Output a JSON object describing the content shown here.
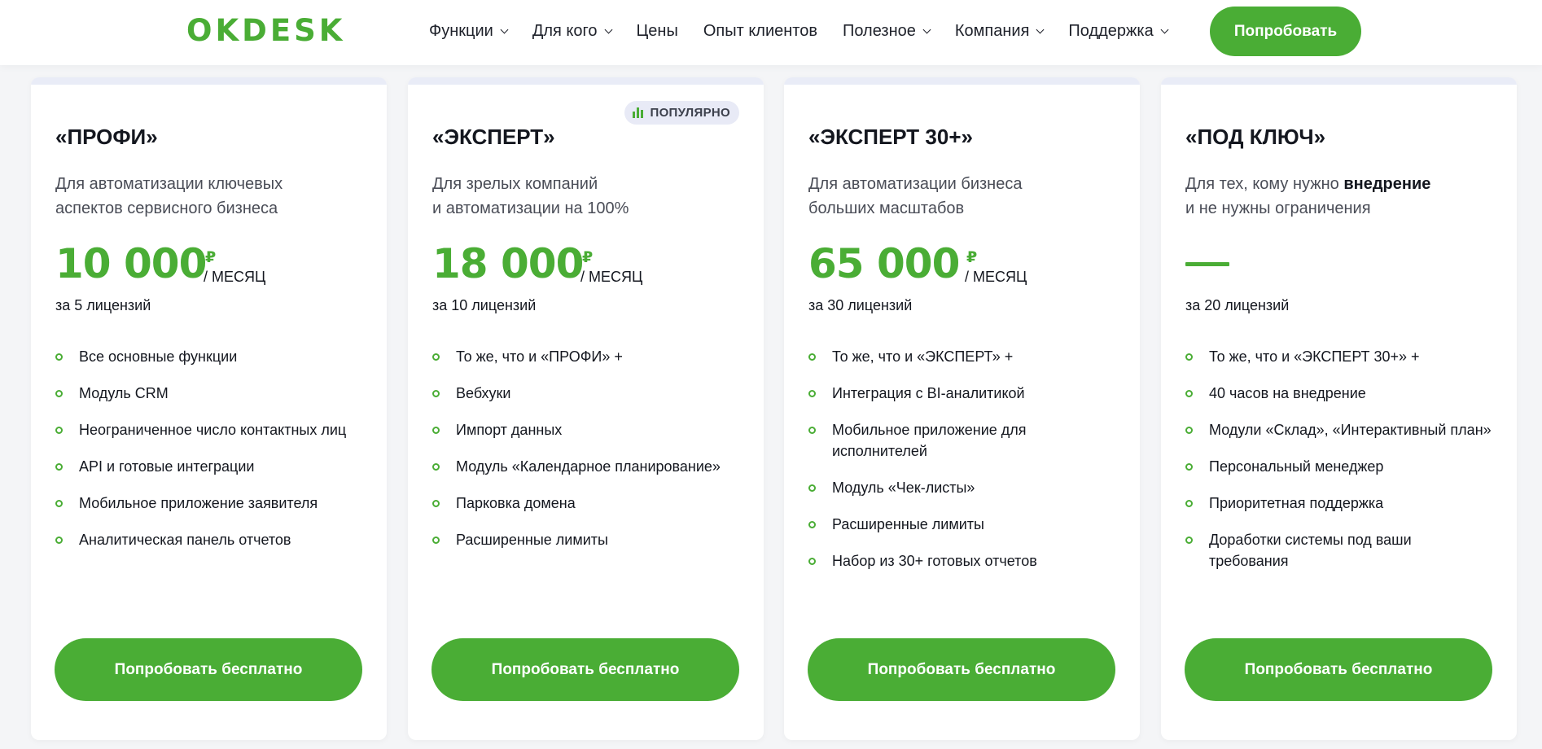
{
  "header": {
    "logo": "OKDESK",
    "nav": [
      {
        "label": "Функции",
        "has_dropdown": true
      },
      {
        "label": "Для кого",
        "has_dropdown": true
      },
      {
        "label": "Цены",
        "has_dropdown": false
      },
      {
        "label": "Опыт клиентов",
        "has_dropdown": false
      },
      {
        "label": "Полезное",
        "has_dropdown": true
      },
      {
        "label": "Компания",
        "has_dropdown": true
      },
      {
        "label": "Поддержка",
        "has_dropdown": true
      }
    ],
    "try_button": "Попробовать"
  },
  "colors": {
    "accent": "#4aad35",
    "badge_bg": "#e8eaf6",
    "page_bg": "#f4f5f7"
  },
  "plans": [
    {
      "title": "«ПРОФИ»",
      "desc_line1": "Для автоматизации ключевых",
      "desc_line2": "аспектов сервисного бизнеса",
      "price": "10 000",
      "currency": "₽",
      "period": "/ МЕСЯЦ",
      "licenses": "за 5 лицензий",
      "features": [
        "Все основные функции",
        "Модуль CRM",
        "Неограниченное число контактных лиц",
        "API и готовые интеграции",
        "Мобильное приложение заявителя",
        "Аналитическая панель отчетов"
      ],
      "button": "Попробовать бесплатно"
    },
    {
      "title": "«ЭКСПЕРТ»",
      "badge": "ПОПУЛЯРНО",
      "desc_line1": "Для зрелых компаний",
      "desc_line2": "и автоматизации на 100%",
      "price": "18 000",
      "currency": "₽",
      "period": "/ МЕСЯЦ",
      "licenses": "за 10 лицензий",
      "features": [
        "То же, что и «ПРОФИ» +",
        "Вебхуки",
        "Импорт данных",
        "Модуль «Календарное планирование»",
        "Парковка домена",
        "Расширенные лимиты"
      ],
      "button": "Попробовать бесплатно"
    },
    {
      "title": "«ЭКСПЕРТ 30+»",
      "desc_line1": "Для автоматизации бизнеса",
      "desc_line2": "больших масштабов",
      "price": "65 000",
      "currency": "₽",
      "period": "/ МЕСЯЦ",
      "licenses": "за 30 лицензий",
      "features": [
        "То же, что и «ЭКСПЕРТ» +",
        "Интеграция с BI-аналитикой",
        "Мобильное приложение для исполнителей",
        "Модуль «Чек-листы»",
        "Расширенные лимиты",
        "Набор из 30+ готовых отчетов"
      ],
      "button": "Попробовать бесплатно"
    },
    {
      "title": "«ПОД КЛЮЧ»",
      "desc_line1_pre": "Для тех, кому нужно ",
      "desc_line1_bold": "внедрение",
      "desc_line2": "и не нужны ограничения",
      "licenses": "за 20 лицензий",
      "features": [
        "То же, что и «ЭКСПЕРТ 30+» +",
        "40 часов на внедрение",
        "Модули «Склад», «Интерактивный план»",
        "Персональный менеджер",
        "Приоритетная поддержка",
        "Доработки системы под ваши требования"
      ],
      "button": "Попробовать бесплатно"
    }
  ]
}
